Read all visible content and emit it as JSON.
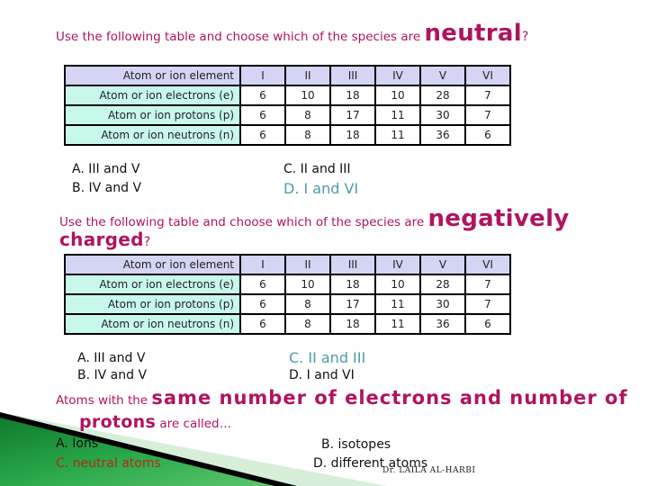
{
  "question1": {
    "prefix": "Use the following table and choose which of the species are ",
    "emphasis": "neutral",
    "suffix": "?",
    "table": {
      "header_label": "Atom or ion element",
      "columns": [
        "I",
        "II",
        "III",
        "IV",
        "V",
        "VI"
      ],
      "rows": [
        {
          "label": "Atom or ion electrons (e)",
          "values": [
            "6",
            "10",
            "18",
            "10",
            "28",
            "7"
          ]
        },
        {
          "label": "Atom or ion protons (p)",
          "values": [
            "6",
            "8",
            "17",
            "11",
            "30",
            "7"
          ]
        },
        {
          "label": "Atom or ion neutrons (n)",
          "values": [
            "6",
            "8",
            "18",
            "11",
            "36",
            "6"
          ]
        }
      ]
    },
    "options": {
      "A": "A.  III and V",
      "B": "B.  IV and V",
      "C": "C. II and III",
      "D": "D. I and VI"
    },
    "highlighted_option": "D"
  },
  "question2": {
    "prefix": "Use the following table and choose which of the species are ",
    "emphasis_line1": "negatively",
    "emphasis_line2": "charged",
    "suffix": "?",
    "table": {
      "header_label": "Atom or ion element",
      "columns": [
        "I",
        "II",
        "III",
        "IV",
        "V",
        "VI"
      ],
      "rows": [
        {
          "label": "Atom or ion electrons (e)",
          "values": [
            "6",
            "10",
            "18",
            "10",
            "28",
            "7"
          ]
        },
        {
          "label": "Atom or ion protons (p)",
          "values": [
            "6",
            "8",
            "17",
            "11",
            "30",
            "7"
          ]
        },
        {
          "label": "Atom or ion neutrons (n)",
          "values": [
            "6",
            "8",
            "18",
            "11",
            "36",
            "6"
          ]
        }
      ]
    },
    "options": {
      "A": "A.  III and V",
      "B": "B.  IV and V",
      "C": "C. II and III",
      "D": "D. I and VI"
    },
    "highlighted_option": "C"
  },
  "question3": {
    "prefix": "Atoms with the ",
    "emphasis_line1": "same number of electrons and number of",
    "emphasis_line2": "protons",
    "suffix": " are called…",
    "options": {
      "A": "A. Ions",
      "B": "B. isotopes",
      "C": "C. neutral atoms",
      "D": "D. different atoms"
    },
    "highlighted_option": "C"
  },
  "footer": {
    "credit": "Dr. LAILA AL-HARBI"
  },
  "colors": {
    "question_text": "#b0145f",
    "table_header_bg": "#d4d4f4",
    "table_rowhead_bg": "#c8f8ec",
    "answer_teal": "#4a9ca8",
    "answer_red": "#b52a10",
    "deco_green": "#1f9a3c"
  }
}
